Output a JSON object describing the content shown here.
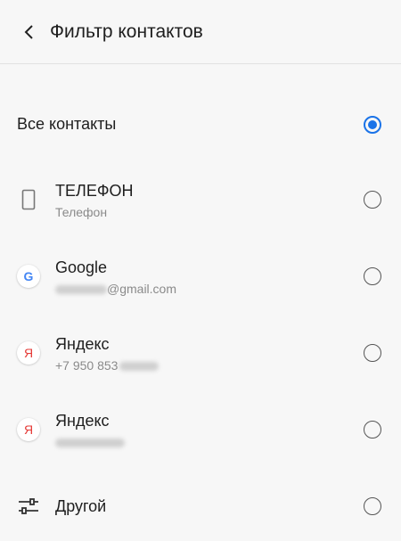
{
  "header": {
    "title": "Фильтр контактов",
    "back_icon": "chevron-left-icon"
  },
  "accent_color": "#1a73e8",
  "all_contacts": {
    "label": "Все контакты",
    "selected": true
  },
  "accounts": [
    {
      "title": "ТЕЛЕФОН",
      "subtitle": "Телефон",
      "icon": "phone-icon",
      "selected": false
    },
    {
      "title": "Google",
      "subtitle_visible": "@gmail.com",
      "icon": "google-icon",
      "selected": false
    },
    {
      "title": "Яндекс",
      "subtitle_visible": "+7 950 853",
      "icon": "yandex-icon",
      "selected": false
    },
    {
      "title": "Яндекс",
      "icon": "yandex-icon",
      "selected": false
    },
    {
      "title": "Другой",
      "icon": "sliders-icon",
      "selected": false
    }
  ],
  "icon_glyphs": {
    "google": "G",
    "yandex": "Я"
  }
}
